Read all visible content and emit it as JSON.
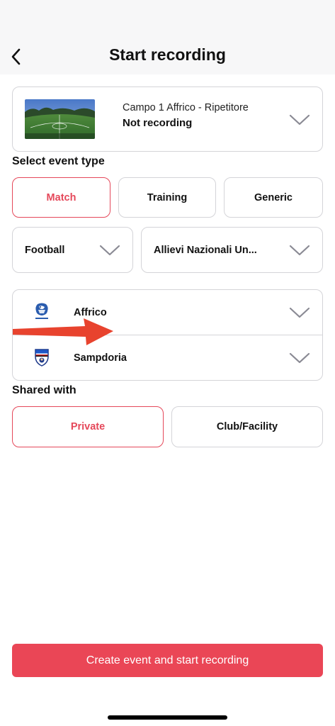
{
  "header": {
    "title": "Start recording",
    "back_icon": "chevron-left-icon"
  },
  "camera": {
    "name": "Campo 1 Affrico - Ripetitore",
    "status": "Not recording",
    "thumbnail_icon": "football-pitch-thumbnail"
  },
  "event_type": {
    "label": "Select event type",
    "options": [
      "Match",
      "Training",
      "Generic"
    ],
    "selected": "Match"
  },
  "sport": {
    "value": "Football"
  },
  "category": {
    "value": "Allievi Nazionali Un..."
  },
  "teams": [
    {
      "name": "Affrico",
      "logo": "affrico-crest-icon"
    },
    {
      "name": "Sampdoria",
      "logo": "sampdoria-shield-icon"
    }
  ],
  "shared_with": {
    "label": "Shared with",
    "options": [
      "Private",
      "Club/Facility"
    ],
    "selected": "Private"
  },
  "cta": {
    "label": "Create event and start recording"
  },
  "colors": {
    "accent": "#e5485a",
    "cta_background": "#ea4656",
    "border": "#d4d4d8",
    "annotation_arrow": "#e8432e"
  }
}
